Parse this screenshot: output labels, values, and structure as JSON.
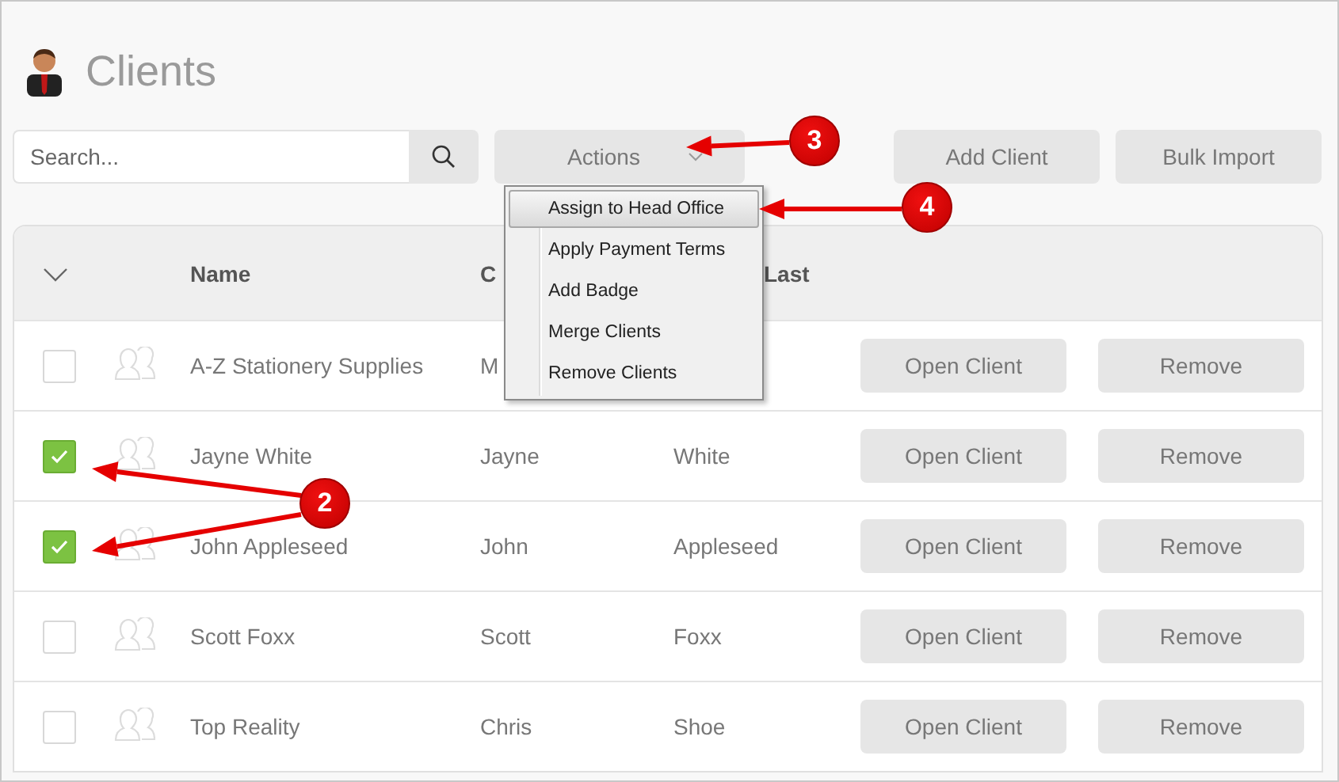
{
  "page": {
    "title": "Clients"
  },
  "toolbar": {
    "search": {
      "placeholder": "Search..."
    },
    "actions_button": "Actions",
    "buttons": [
      "Add Client",
      "Bulk Import"
    ]
  },
  "actions_menu": {
    "items": [
      {
        "label": "Assign to Head Office",
        "selected": true
      },
      {
        "label": "Apply Payment Terms",
        "selected": false
      },
      {
        "label": "Add Badge",
        "selected": false
      },
      {
        "label": "Merge Clients",
        "selected": false
      },
      {
        "label": "Remove Clients",
        "selected": false
      }
    ]
  },
  "table": {
    "columns": [
      "Name",
      "C",
      "Last"
    ],
    "rows": [
      {
        "checked": false,
        "name": "A-Z Stationery Supplies",
        "first": "M",
        "open": "Open Client",
        "remove": "Remove"
      },
      {
        "checked": true,
        "name": "Jayne White",
        "first": "Jayne",
        "last": "White",
        "open": "Open Client",
        "remove": "Remove"
      },
      {
        "checked": true,
        "name": "John Appleseed",
        "first": "John",
        "last": "Appleseed",
        "open": "Open Client",
        "remove": "Remove"
      },
      {
        "checked": false,
        "name": "Scott Foxx",
        "first": "Scott",
        "last": "Foxx",
        "open": "Open Client",
        "remove": "Remove"
      },
      {
        "checked": false,
        "name": "Top Reality",
        "first": "Chris",
        "last": "Shoe",
        "open": "Open Client",
        "remove": "Remove"
      }
    ]
  },
  "callouts": [
    {
      "number": "3"
    },
    {
      "number": "4"
    },
    {
      "number": "2"
    }
  ]
}
